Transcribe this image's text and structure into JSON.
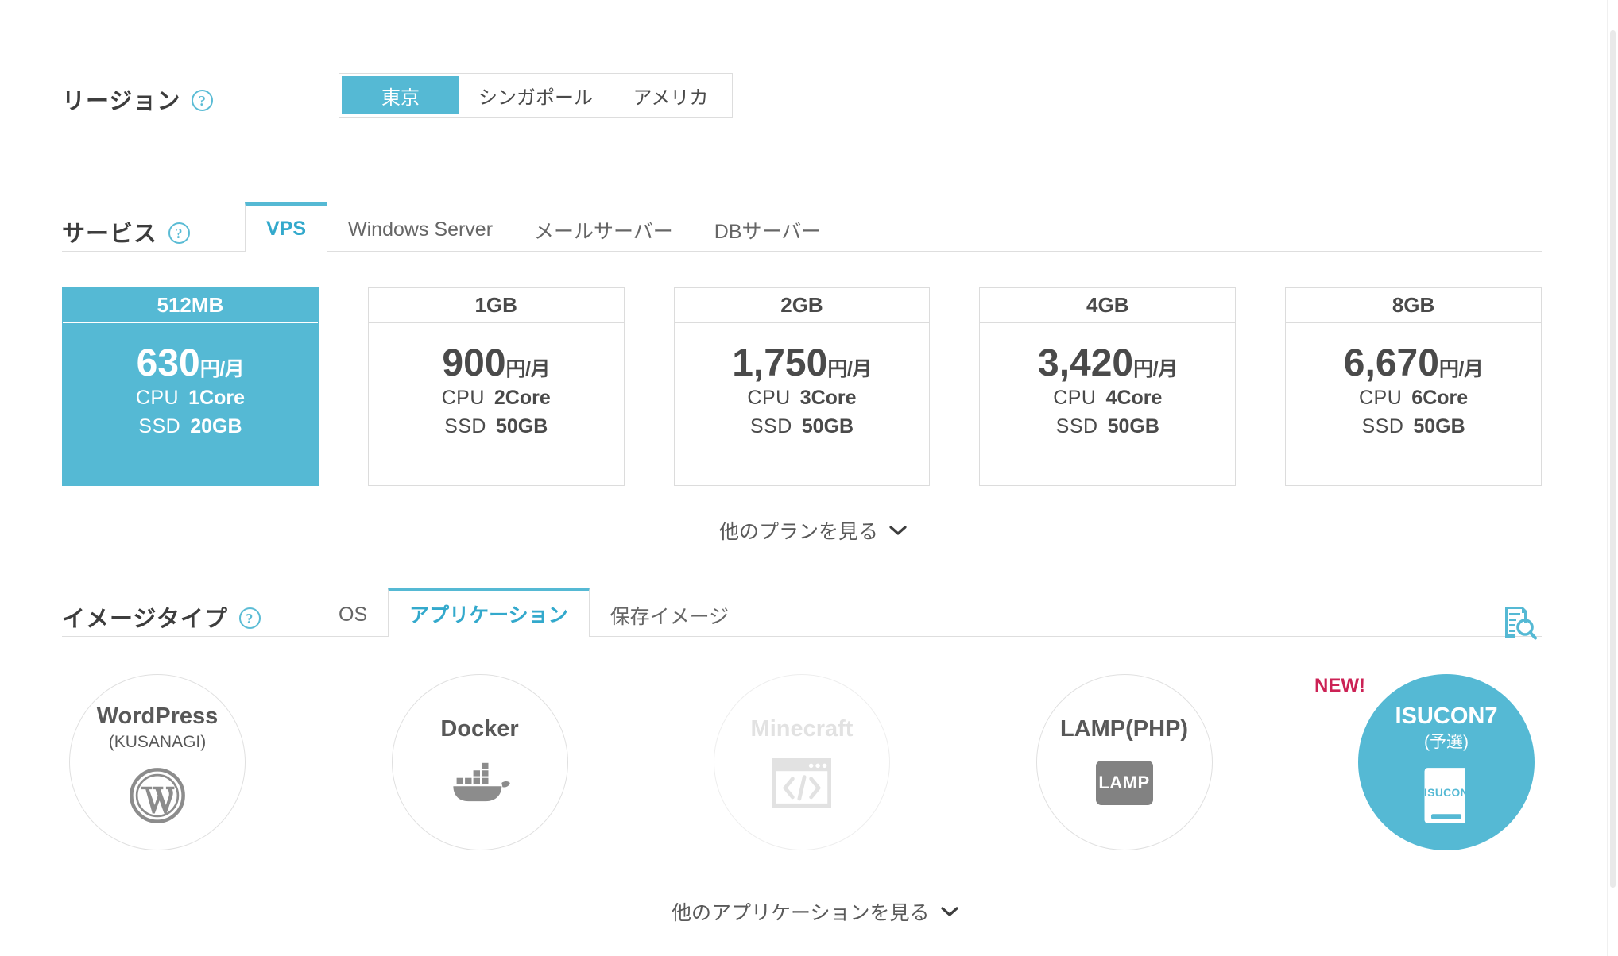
{
  "region": {
    "label": "リージョン",
    "help_icon": "help-circle-icon",
    "options": [
      {
        "label": "東京",
        "selected": true
      },
      {
        "label": "シンガポール",
        "selected": false
      },
      {
        "label": "アメリカ",
        "selected": false
      }
    ]
  },
  "service": {
    "label": "サービス",
    "help_icon": "help-circle-icon",
    "tabs": [
      {
        "label": "VPS",
        "active": true
      },
      {
        "label": "Windows Server",
        "active": false
      },
      {
        "label": "メールサーバー",
        "active": false
      },
      {
        "label": "DBサーバー",
        "active": false
      }
    ]
  },
  "plans": {
    "cpu_label": "CPU",
    "ssd_label": "SSD",
    "items": [
      {
        "memory": "512MB",
        "price": "630",
        "unit": "円/月",
        "cpu": "1Core",
        "ssd": "20GB",
        "selected": true
      },
      {
        "memory": "1GB",
        "price": "900",
        "unit": "円/月",
        "cpu": "2Core",
        "ssd": "50GB",
        "selected": false
      },
      {
        "memory": "2GB",
        "price": "1,750",
        "unit": "円/月",
        "cpu": "3Core",
        "ssd": "50GB",
        "selected": false
      },
      {
        "memory": "4GB",
        "price": "3,420",
        "unit": "円/月",
        "cpu": "4Core",
        "ssd": "50GB",
        "selected": false
      },
      {
        "memory": "8GB",
        "price": "6,670",
        "unit": "円/月",
        "cpu": "6Core",
        "ssd": "50GB",
        "selected": false
      }
    ],
    "more_label": "他のプランを見る",
    "more_icon": "chevron-down-icon"
  },
  "image_type": {
    "label": "イメージタイプ",
    "help_icon": "help-circle-icon",
    "tabs": [
      {
        "label": "OS",
        "active": false
      },
      {
        "label": "アプリケーション",
        "active": true
      },
      {
        "label": "保存イメージ",
        "active": false
      }
    ],
    "search_icon": "document-search-icon"
  },
  "applications": {
    "items": [
      {
        "name": "WordPress",
        "sub": "(KUSANAGI)",
        "icon": "wordpress-icon",
        "selected": false,
        "disabled": false,
        "badge": ""
      },
      {
        "name": "Docker",
        "sub": "",
        "icon": "docker-whale-icon",
        "selected": false,
        "disabled": false,
        "badge": ""
      },
      {
        "name": "Minecraft",
        "sub": "",
        "icon": "code-window-icon",
        "selected": false,
        "disabled": true,
        "badge": ""
      },
      {
        "name": "LAMP(PHP)",
        "sub": "",
        "icon": "lamp-badge-icon",
        "lamp_text": "LAMP",
        "selected": false,
        "disabled": false,
        "badge": ""
      },
      {
        "name": "ISUCON7",
        "sub": "(予選)",
        "icon": "isucon-book-icon",
        "isucon_text": "ISUCON",
        "selected": true,
        "disabled": false,
        "badge": "NEW!"
      }
    ],
    "more_label": "他のアプリケーションを見る",
    "more_icon": "chevron-down-icon"
  },
  "colors": {
    "accent": "#55b9d4",
    "accent_text": "#33a9cc",
    "new_badge": "#cc2255",
    "text": "#4a4a4a",
    "border": "#dcdcdc"
  }
}
